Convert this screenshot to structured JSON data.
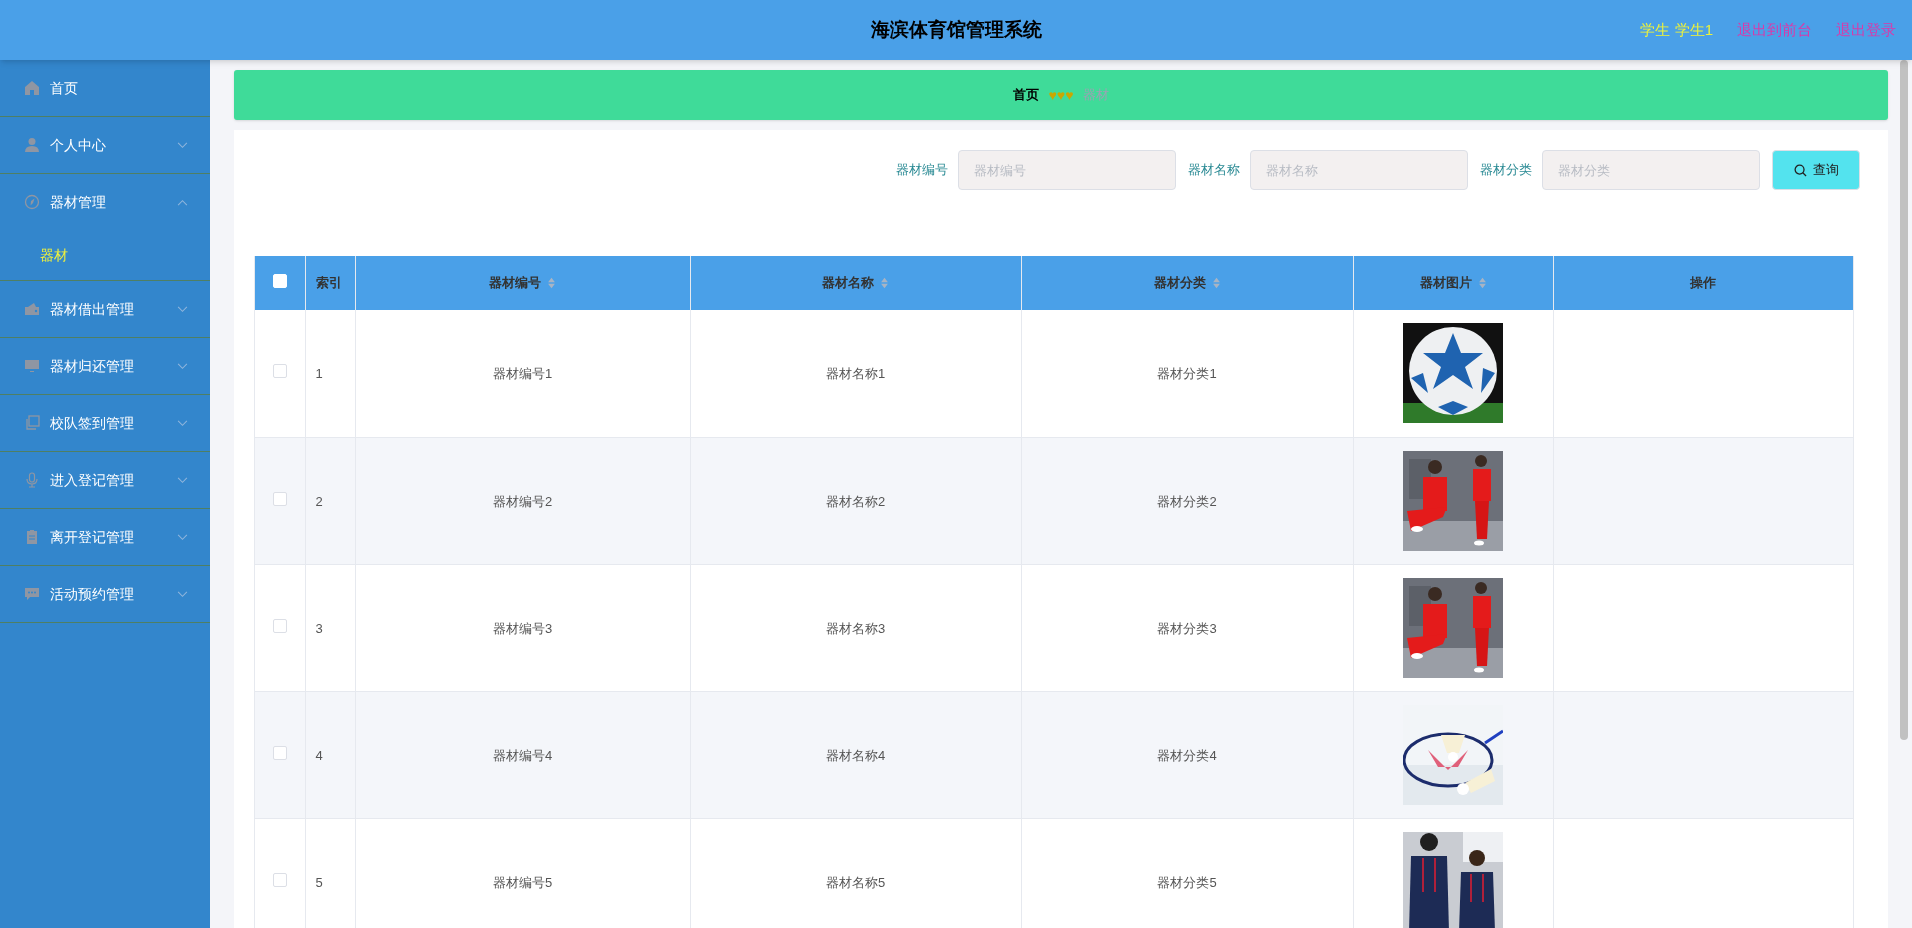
{
  "header": {
    "title": "海滨体育馆管理系统",
    "user": "学生 学生1",
    "links": [
      "退出到前台",
      "退出登录"
    ]
  },
  "sidebar": {
    "items": [
      {
        "label": "首页"
      },
      {
        "label": "个人中心",
        "expandable": true,
        "expanded": false
      },
      {
        "label": "器材管理",
        "expandable": true,
        "expanded": true,
        "children": [
          {
            "label": "器材",
            "selected": true
          }
        ]
      },
      {
        "label": "器材借出管理",
        "expandable": true,
        "expanded": false
      },
      {
        "label": "器材归还管理",
        "expandable": true,
        "expanded": false
      },
      {
        "label": "校队签到管理",
        "expandable": true,
        "expanded": false
      },
      {
        "label": "进入登记管理",
        "expandable": true,
        "expanded": false
      },
      {
        "label": "离开登记管理",
        "expandable": true,
        "expanded": false
      },
      {
        "label": "活动预约管理",
        "expandable": true,
        "expanded": false
      }
    ]
  },
  "breadcrumb": {
    "home": "首页",
    "separator": "♥♥♥",
    "current": "器材"
  },
  "search": {
    "fields": [
      {
        "label": "器材编号",
        "placeholder": "器材编号"
      },
      {
        "label": "器材名称",
        "placeholder": "器材名称"
      },
      {
        "label": "器材分类",
        "placeholder": "器材分类"
      }
    ],
    "button": "查询"
  },
  "table": {
    "select_all": {
      "checked": false
    },
    "columns": [
      {
        "label": "索引",
        "sortable": false
      },
      {
        "label": "器材编号",
        "sortable": true
      },
      {
        "label": "器材名称",
        "sortable": true
      },
      {
        "label": "器材分类",
        "sortable": true
      },
      {
        "label": "器材图片",
        "sortable": true
      },
      {
        "label": "操作",
        "sortable": false
      }
    ],
    "rows": [
      {
        "checked": false,
        "index": "1",
        "code": "器材编号1",
        "name": "器材名称1",
        "category": "器材分类1"
      },
      {
        "checked": false,
        "index": "2",
        "code": "器材编号2",
        "name": "器材名称2",
        "category": "器材分类2"
      },
      {
        "checked": false,
        "index": "3",
        "code": "器材编号3",
        "name": "器材名称3",
        "category": "器材分类3"
      },
      {
        "checked": false,
        "index": "4",
        "code": "器材编号4",
        "name": "器材名称4",
        "category": "器材分类4"
      },
      {
        "checked": false,
        "index": "5",
        "code": "器材编号5",
        "name": "器材名称5",
        "category": "器材分类5"
      }
    ]
  }
}
